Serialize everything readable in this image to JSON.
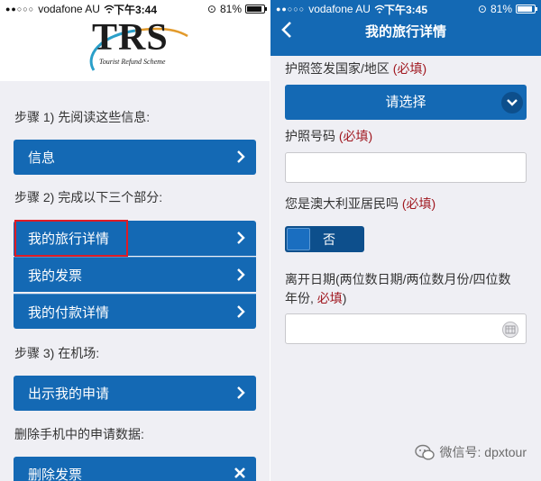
{
  "left": {
    "status": {
      "carrier": "vodafone AU",
      "time": "下午3:44",
      "battery": "81%",
      "battery_level": 0.81
    },
    "logo": {
      "text": "TRS",
      "subtitle": "Tourist Refund Scheme"
    },
    "step1": "步骤 1) 先阅读这些信息:",
    "info_button": "信息",
    "step2": "步骤 2) 完成以下三个部分:",
    "travel_details_button": "我的旅行详情",
    "invoices_button": "我的发票",
    "payment_details_button": "我的付款详情",
    "step3": "步骤 3) 在机场:",
    "show_claim_button": "出示我的申请",
    "delete_heading": "删除手机中的申请数据:",
    "delete_invoices_button": "删除发票"
  },
  "right": {
    "status": {
      "carrier": "vodafone AU",
      "time": "下午3:45",
      "battery": "81%",
      "battery_level": 0.81
    },
    "nav_title": "我的旅行详情",
    "passport_country_label": "护照签发国家/地区",
    "passport_country_required": "(必填)",
    "select_button": "请选择",
    "passport_number_label": "护照号码",
    "passport_number_required": "(必填)",
    "passport_number_value": "",
    "resident_label": "您是澳大利亚居民吗",
    "resident_required": "(必填)",
    "resident_toggle": "否",
    "departure_label_line1": "离开日期(两位数日期/两位数月份/四位数",
    "departure_label_line2": "年份,",
    "departure_required": "必填",
    "departure_label_close": ")",
    "departure_value": ""
  },
  "watermark": "微信号: dpxtour",
  "colors": {
    "primary": "#1469b4",
    "dark": "#0d4f8c",
    "required": "#a0171f",
    "highlight": "#e01b24"
  }
}
